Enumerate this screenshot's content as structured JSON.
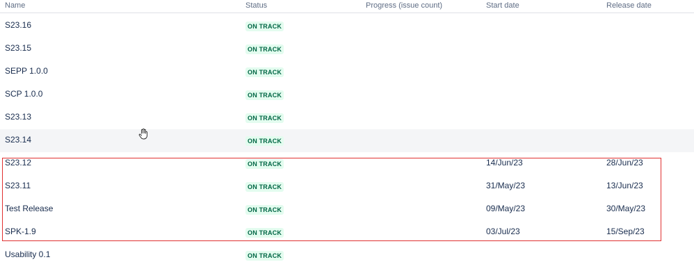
{
  "columns": {
    "name": "Name",
    "status": "Status",
    "progress": "Progress (issue count)",
    "start_date": "Start date",
    "release_date": "Release date"
  },
  "rows": [
    {
      "name": "S23.16",
      "status": "ON TRACK",
      "start_date": "",
      "release_date": ""
    },
    {
      "name": "S23.15",
      "status": "ON TRACK",
      "start_date": "",
      "release_date": ""
    },
    {
      "name": "SEPP 1.0.0",
      "status": "ON TRACK",
      "start_date": "",
      "release_date": ""
    },
    {
      "name": "SCP 1.0.0",
      "status": "ON TRACK",
      "start_date": "",
      "release_date": ""
    },
    {
      "name": "S23.13",
      "status": "ON TRACK",
      "start_date": "",
      "release_date": ""
    },
    {
      "name": "S23.14",
      "status": "ON TRACK",
      "start_date": "",
      "release_date": ""
    },
    {
      "name": "S23.12",
      "status": "ON TRACK",
      "start_date": "14/Jun/23",
      "release_date": "28/Jun/23"
    },
    {
      "name": "S23.11",
      "status": "ON TRACK",
      "start_date": "31/May/23",
      "release_date": "13/Jun/23"
    },
    {
      "name": "Test Release",
      "status": "ON TRACK",
      "start_date": "09/May/23",
      "release_date": "30/May/23"
    },
    {
      "name": "SPK-1.9",
      "status": "ON TRACK",
      "start_date": "03/Jul/23",
      "release_date": "15/Sep/23"
    },
    {
      "name": "Usability 0.1",
      "status": "ON TRACK",
      "start_date": "",
      "release_date": ""
    }
  ],
  "colors": {
    "lozenge_bg": "#e3fcef",
    "lozenge_text": "#006644",
    "highlight_border": "#e03030",
    "hover_row_bg": "#f4f5f7"
  },
  "icons": {
    "cursor": "hand-pointer-icon"
  }
}
